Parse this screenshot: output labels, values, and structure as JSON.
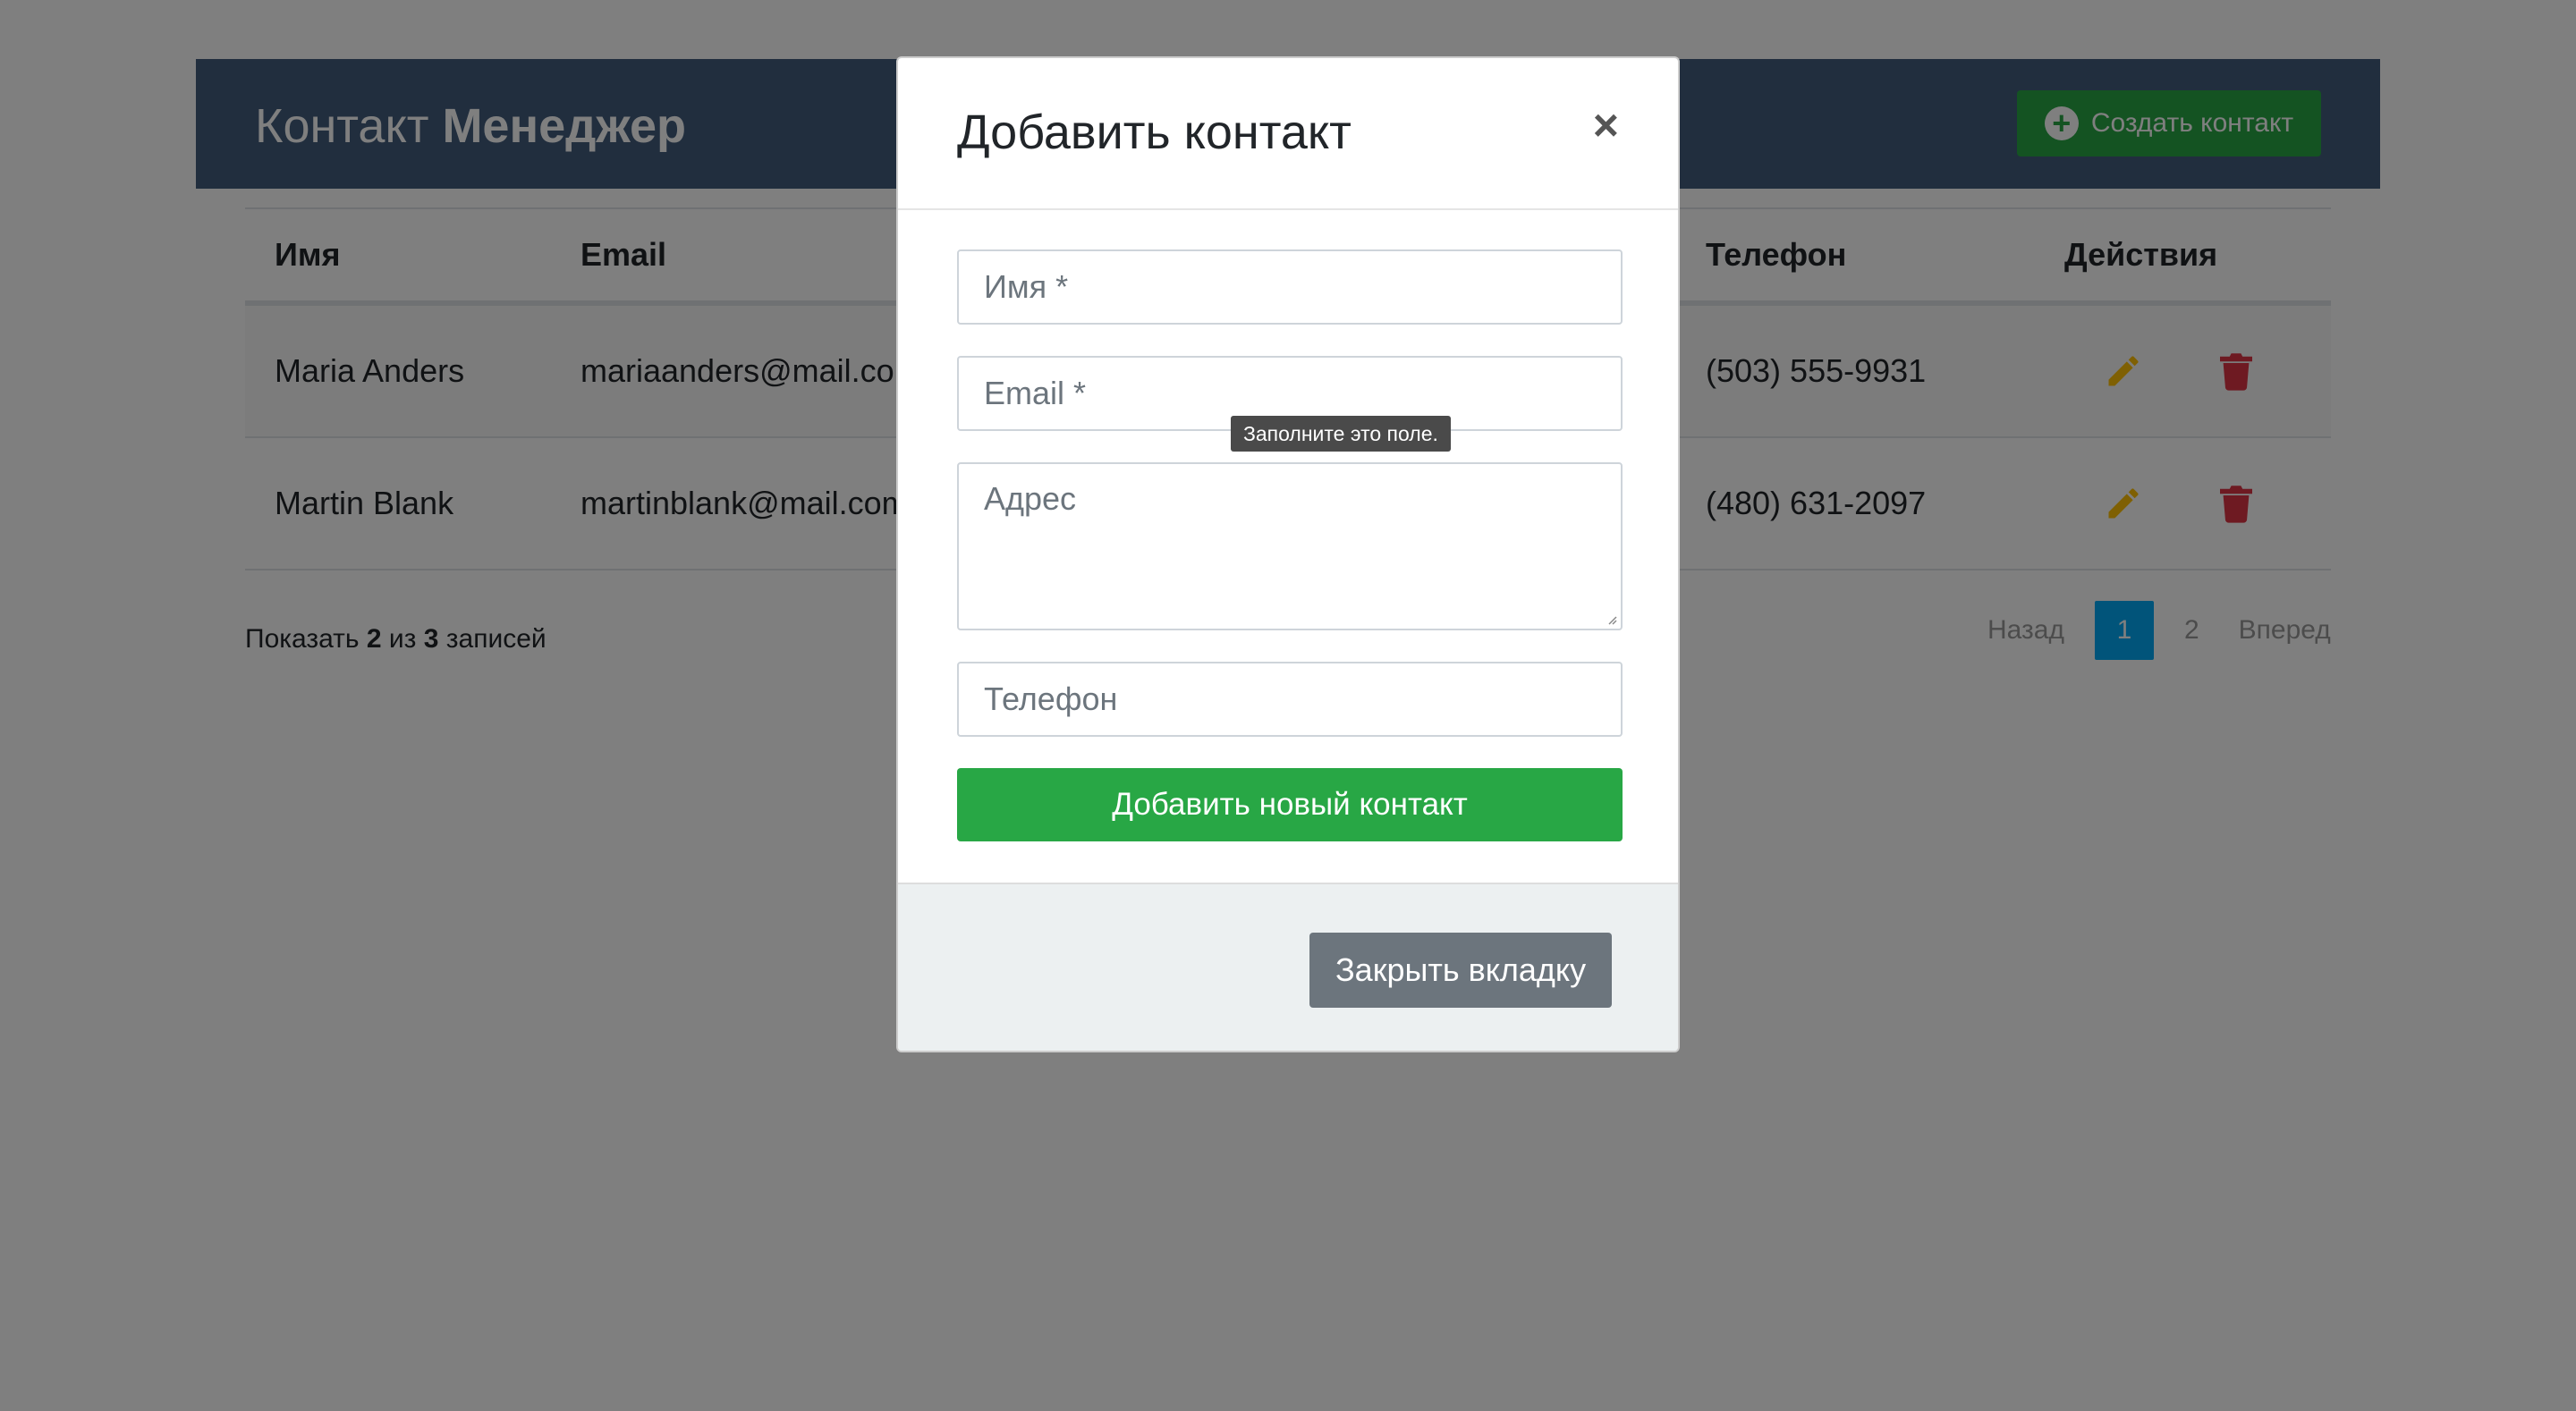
{
  "header": {
    "title_regular": "Контакт",
    "title_bold": "Менеджер",
    "create_button_label": "Создать контакт"
  },
  "table": {
    "headers": {
      "name": "Имя",
      "email": "Email",
      "phone": "Телефон",
      "actions": "Действия"
    },
    "rows": [
      {
        "name": "Maria Anders",
        "email": "mariaanders@mail.com",
        "phone": "(503) 555-9931"
      },
      {
        "name": "Martin Blank",
        "email": "martinblank@mail.com",
        "phone": "(480) 631-2097"
      }
    ]
  },
  "footer": {
    "show_prefix": "Показать",
    "shown_count": "2",
    "of": "из",
    "total_count": "3",
    "records": "записей"
  },
  "pagination": {
    "prev": "Назад",
    "pages": [
      "1",
      "2"
    ],
    "active_page": "1",
    "next": "Вперед"
  },
  "modal": {
    "title": "Добавить контакт",
    "close_symbol": "×",
    "fields": {
      "name_placeholder": "Имя *",
      "email_placeholder": "Email *",
      "address_placeholder": "Адрес",
      "phone_placeholder": "Телефон"
    },
    "validation_tooltip": "Заполните это поле.",
    "submit_label": "Добавить новый контакт",
    "close_tab_label": "Закрыть вкладку"
  },
  "colors": {
    "header_bg": "#435d7d",
    "success": "#28a745",
    "active_page": "#03a9f4",
    "edit_icon": "#ffc107",
    "delete_icon": "#dc3545",
    "secondary": "#6c757d"
  },
  "icons": {
    "create": "plus-circle-icon",
    "edit": "pencil-icon",
    "delete": "trash-icon",
    "close": "close-icon"
  }
}
